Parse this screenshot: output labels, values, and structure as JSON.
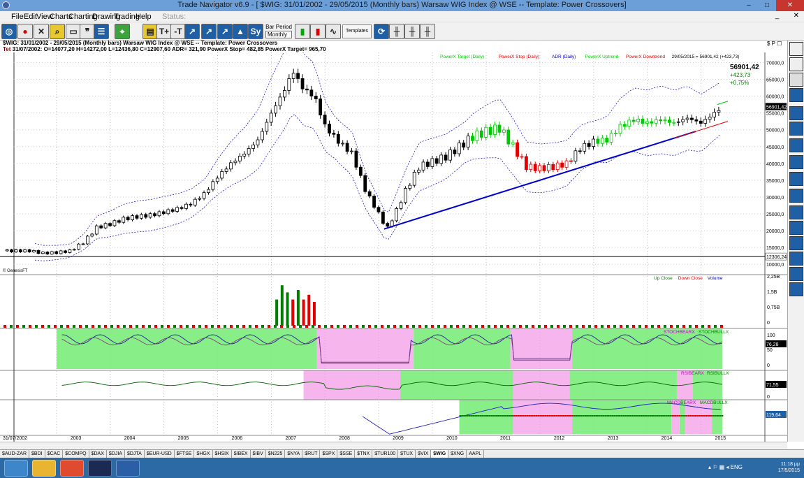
{
  "window": {
    "title": "Trade Navigator v6.9 - [ $WIG: 31/01/2002 - 29/05/2015  (Monthly bars)   Warsaw WIG Index @ WSE  --  Template: Power Crossovers]",
    "buttons": [
      "–",
      "□",
      "✕"
    ]
  },
  "menu": {
    "items": [
      "File",
      "Edit",
      "View",
      "Charts",
      "Charting",
      "Drawing",
      "Trading",
      "Help"
    ],
    "status": "Status:",
    "mdi": "_   ✕"
  },
  "toolbar": {
    "bar_period_label": "Bar Period",
    "bar_period_value": "Monthly",
    "templates_label": "Templates"
  },
  "info": {
    "line1": "$WIG:  31/01/2002 - 29/05/2015  (Monthly bars)   Warsaw WIG Index @ WSE  --  Template: Power Crossovers",
    "line2_prefix": "Tet",
    "line2": "31/07/2002:  O=14077,20  H=14272,00  L=12436,80  C=12907,60  ADR= 321,90  PowerX Stop= 482,85  PowerX Target= 965,70",
    "corner": "$ P ☐"
  },
  "legend": [
    {
      "label": "PowerX Target (Daily)",
      "color": "#00c800"
    },
    {
      "label": "PowerX Stop (Daily)",
      "color": "#e00000"
    },
    {
      "label": "ADR (Daily)",
      "color": "#0000d0"
    },
    {
      "label": "PowerX Uptrend",
      "color": "#00d000"
    },
    {
      "label": "PowerX Downtrend",
      "color": "#e00000"
    }
  ],
  "quote": {
    "date_value": "29/05/2015 = 56901,42 (+423,73)",
    "last": "56901,42",
    "change": "+423,73",
    "pct": "+0,75%"
  },
  "price_axis": [
    "70000,0",
    "65000,0",
    "60000,0",
    "55000,0",
    "50000,0",
    "45000,0",
    "40000,0",
    "35000,0",
    "30000,0",
    "25000,0",
    "20000,0",
    "15000,0",
    "10000,0"
  ],
  "price_tags": {
    "last": "56901,42",
    "low": "12306,24"
  },
  "genesis": "© GenesisFT",
  "volume": {
    "legend": [
      {
        "label": "Up Close",
        "color": "#008000"
      },
      {
        "label": "Down Close",
        "color": "#e00000"
      },
      {
        "label": "Volume",
        "color": "#0000d0"
      }
    ],
    "axis": [
      "2,25B",
      "1,5B",
      "0,75B",
      "0"
    ]
  },
  "stoch": {
    "labels": [
      "STOCHBEARX",
      "STOCHBULLX"
    ],
    "axis": [
      "100",
      "50",
      "0"
    ],
    "tag": "76,28"
  },
  "rsi": {
    "labels": [
      "RSIBEARX",
      "RSIBULLX"
    ],
    "axis": [
      "0"
    ],
    "tag": "71,55"
  },
  "macd": {
    "labels": [
      "MACDBEARX",
      "MACDBULLX"
    ],
    "tag": "119,64"
  },
  "xaxis": {
    "corner": "31/07/2002",
    "years": [
      "2003",
      "2004",
      "2005",
      "2006",
      "2007",
      "2008",
      "2009",
      "2010",
      "2011",
      "2012",
      "2013",
      "2014",
      "2015"
    ]
  },
  "tabs": [
    "$AUD-ZAR",
    "$BDI",
    "$CAC",
    "$COMPQ",
    "$DAX",
    "$DJIA",
    "$DJTA",
    "$EUR-USD",
    "$FTSE",
    "$HGX",
    "$HSIX",
    "$IBEX",
    "$IBV",
    "$N225",
    "$NYA",
    "$RUT",
    "$SPX",
    "$SSE",
    "$TNX",
    "$TUR100",
    "$TUX",
    "$VIX",
    "$WIG",
    "$XNG",
    "AAPL"
  ],
  "active_tab": "$WIG",
  "taskbar": {
    "time": "11:18 μμ",
    "date": "17/5/2015",
    "lang": "ENG"
  },
  "chart_data": {
    "type": "candlestick",
    "title": "Warsaw WIG Index @ WSE (Monthly bars)",
    "ylim": [
      10000,
      72000
    ],
    "x_range": [
      "2002-01",
      "2015-05"
    ],
    "close": [
      [
        2002.5,
        14000
      ],
      [
        2002.75,
        13300
      ],
      [
        2003.0,
        13500
      ],
      [
        2003.25,
        14000
      ],
      [
        2003.5,
        16500
      ],
      [
        2003.75,
        21000
      ],
      [
        2004.0,
        22000
      ],
      [
        2004.25,
        23500
      ],
      [
        2004.5,
        24200
      ],
      [
        2004.75,
        24600
      ],
      [
        2005.0,
        25500
      ],
      [
        2005.25,
        26500
      ],
      [
        2005.5,
        28000
      ],
      [
        2005.75,
        31000
      ],
      [
        2006.0,
        36000
      ],
      [
        2006.25,
        40000
      ],
      [
        2006.5,
        43000
      ],
      [
        2006.75,
        47000
      ],
      [
        2007.0,
        55000
      ],
      [
        2007.25,
        62000
      ],
      [
        2007.4,
        67500
      ],
      [
        2007.6,
        62000
      ],
      [
        2007.8,
        60000
      ],
      [
        2008.0,
        51000
      ],
      [
        2008.25,
        46500
      ],
      [
        2008.5,
        43000
      ],
      [
        2008.75,
        32000
      ],
      [
        2009.0,
        25000
      ],
      [
        2009.15,
        20500
      ],
      [
        2009.3,
        25000
      ],
      [
        2009.5,
        32000
      ],
      [
        2009.75,
        39000
      ],
      [
        2010.0,
        40500
      ],
      [
        2010.25,
        42000
      ],
      [
        2010.5,
        45000
      ],
      [
        2010.75,
        48000
      ],
      [
        2011.0,
        49500
      ],
      [
        2011.25,
        50500
      ],
      [
        2011.5,
        45000
      ],
      [
        2011.75,
        39000
      ],
      [
        2012.0,
        38500
      ],
      [
        2012.25,
        39000
      ],
      [
        2012.5,
        40000
      ],
      [
        2012.75,
        44500
      ],
      [
        2013.0,
        46500
      ],
      [
        2013.25,
        47000
      ],
      [
        2013.5,
        51000
      ],
      [
        2013.75,
        53000
      ],
      [
        2014.0,
        52000
      ],
      [
        2014.25,
        53000
      ],
      [
        2014.5,
        52000
      ],
      [
        2014.75,
        53500
      ],
      [
        2015.0,
        52000
      ],
      [
        2015.25,
        55000
      ],
      [
        2015.4,
        56901
      ]
    ]
  }
}
